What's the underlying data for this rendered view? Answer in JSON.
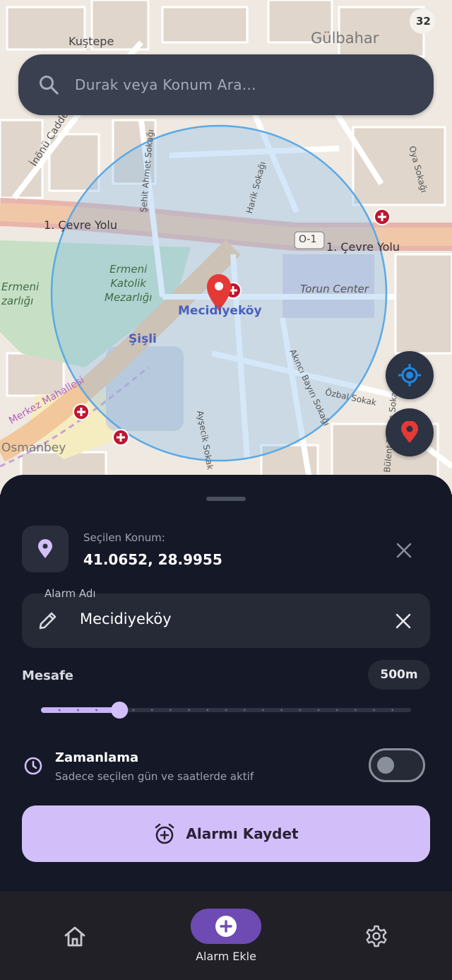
{
  "map": {
    "labels": {
      "kustepe": "Kuştepe",
      "gulbahar": "Gülbahar",
      "inonu": "İnönü Caddesi",
      "cevre_yolu_left": "1. Çevre Yolu",
      "cevre_yolu_right": "1. Çevre Yolu",
      "o1": "O-1",
      "ermeni_katolik": "Ermeni\nKatolik\nMezarlığı",
      "ermeni_mezar": "Ermeni\nzarlığı",
      "torun": "Torun Center",
      "mecidiyekoy": "Mecidiyeköy",
      "sisli": "Şişli",
      "merkez": "Merkez Mahallesi",
      "osmanbey": "Osmanbey",
      "sehit": "Şehit Ahmet Sokağı",
      "harik": "Harik Sokağı",
      "akinci": "Akıncı Bayırı Sokağı",
      "ozbal": "Özbal Sokak",
      "aysecik": "Ayşecik Sokak",
      "oya": "Oya Sokağı",
      "bulent": "Bülent Tarcan Sokağı",
      "badge": "32"
    }
  },
  "search": {
    "placeholder": "Durak veya Konum Ara..."
  },
  "icons": {
    "search": "search-icon",
    "locate": "my-location-icon",
    "pin": "location-pin-icon",
    "close": "close-icon",
    "edit": "pencil-icon",
    "clock": "clock-icon",
    "alarm": "alarm-add-icon",
    "home": "home-icon",
    "add": "add-circle-icon",
    "settings": "gear-icon"
  },
  "sheet": {
    "selected_label": "Seçilen Konum:",
    "selected_value": "41.0652, 28.9955",
    "name_label": "Alarm Adı",
    "name_value": "Mecidiyeköy",
    "distance_label": "Mesafe",
    "distance_value": "500m",
    "slider_fraction": 0.21,
    "schedule_title": "Zamanlama",
    "schedule_sub": "Sadece seçilen gün ve saatlerde aktif",
    "schedule_enabled": false,
    "save_label": "Alarmı Kaydet"
  },
  "nav": {
    "add_label": "Alarm Ekle"
  },
  "colors": {
    "accent": "#d2bffa",
    "nav_active": "#6e4bb3",
    "pin_red": "#e53935",
    "radius_blue": "#5aa9e6"
  }
}
